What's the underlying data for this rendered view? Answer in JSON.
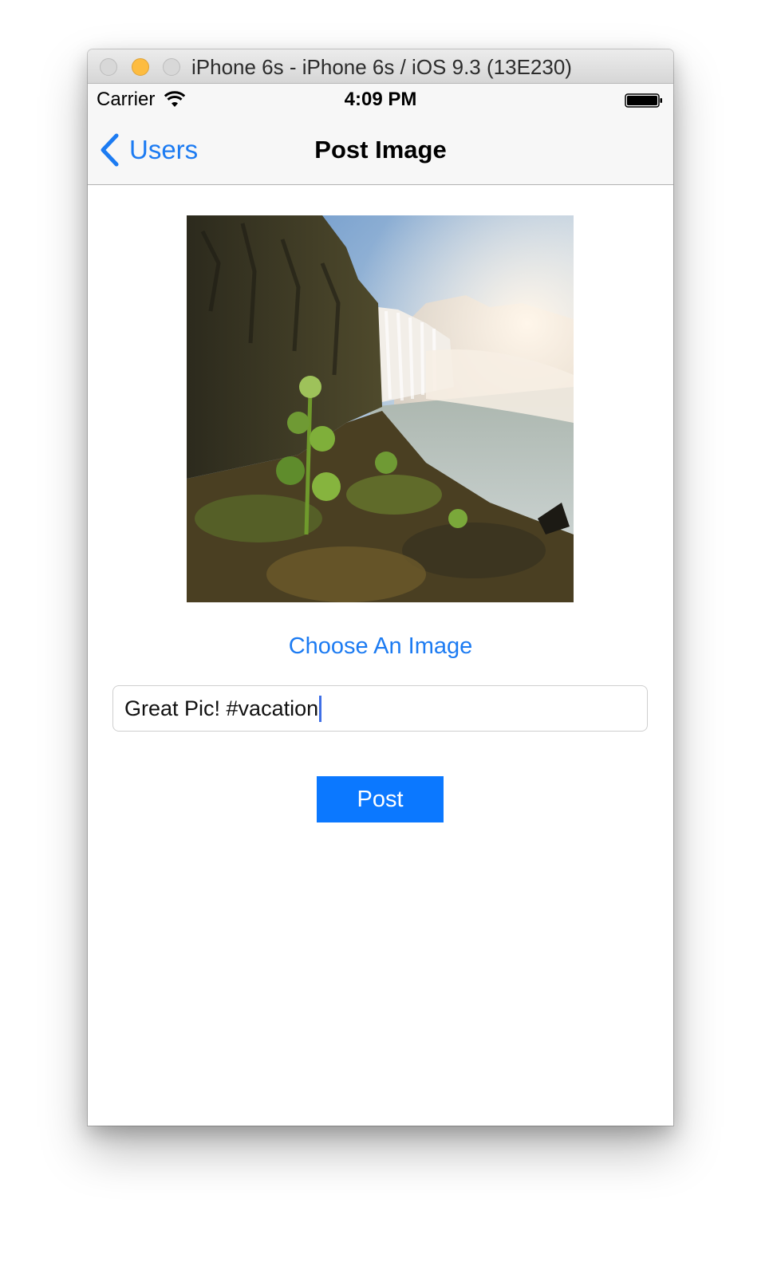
{
  "window": {
    "title": "iPhone 6s - iPhone 6s / iOS 9.3 (13E230)"
  },
  "status_bar": {
    "carrier": "Carrier",
    "time": "4:09 PM",
    "icons": [
      "wifi-icon",
      "battery-icon"
    ]
  },
  "nav_bar": {
    "back_label": "Users",
    "title": "Post Image"
  },
  "content": {
    "image_subject": "waterfall landscape photo",
    "choose_image_label": "Choose An Image",
    "caption_value": "Great Pic! #vacation",
    "post_label": "Post"
  },
  "colors": {
    "accent": "#1c7bf2",
    "post_button": "#0b78ff"
  }
}
